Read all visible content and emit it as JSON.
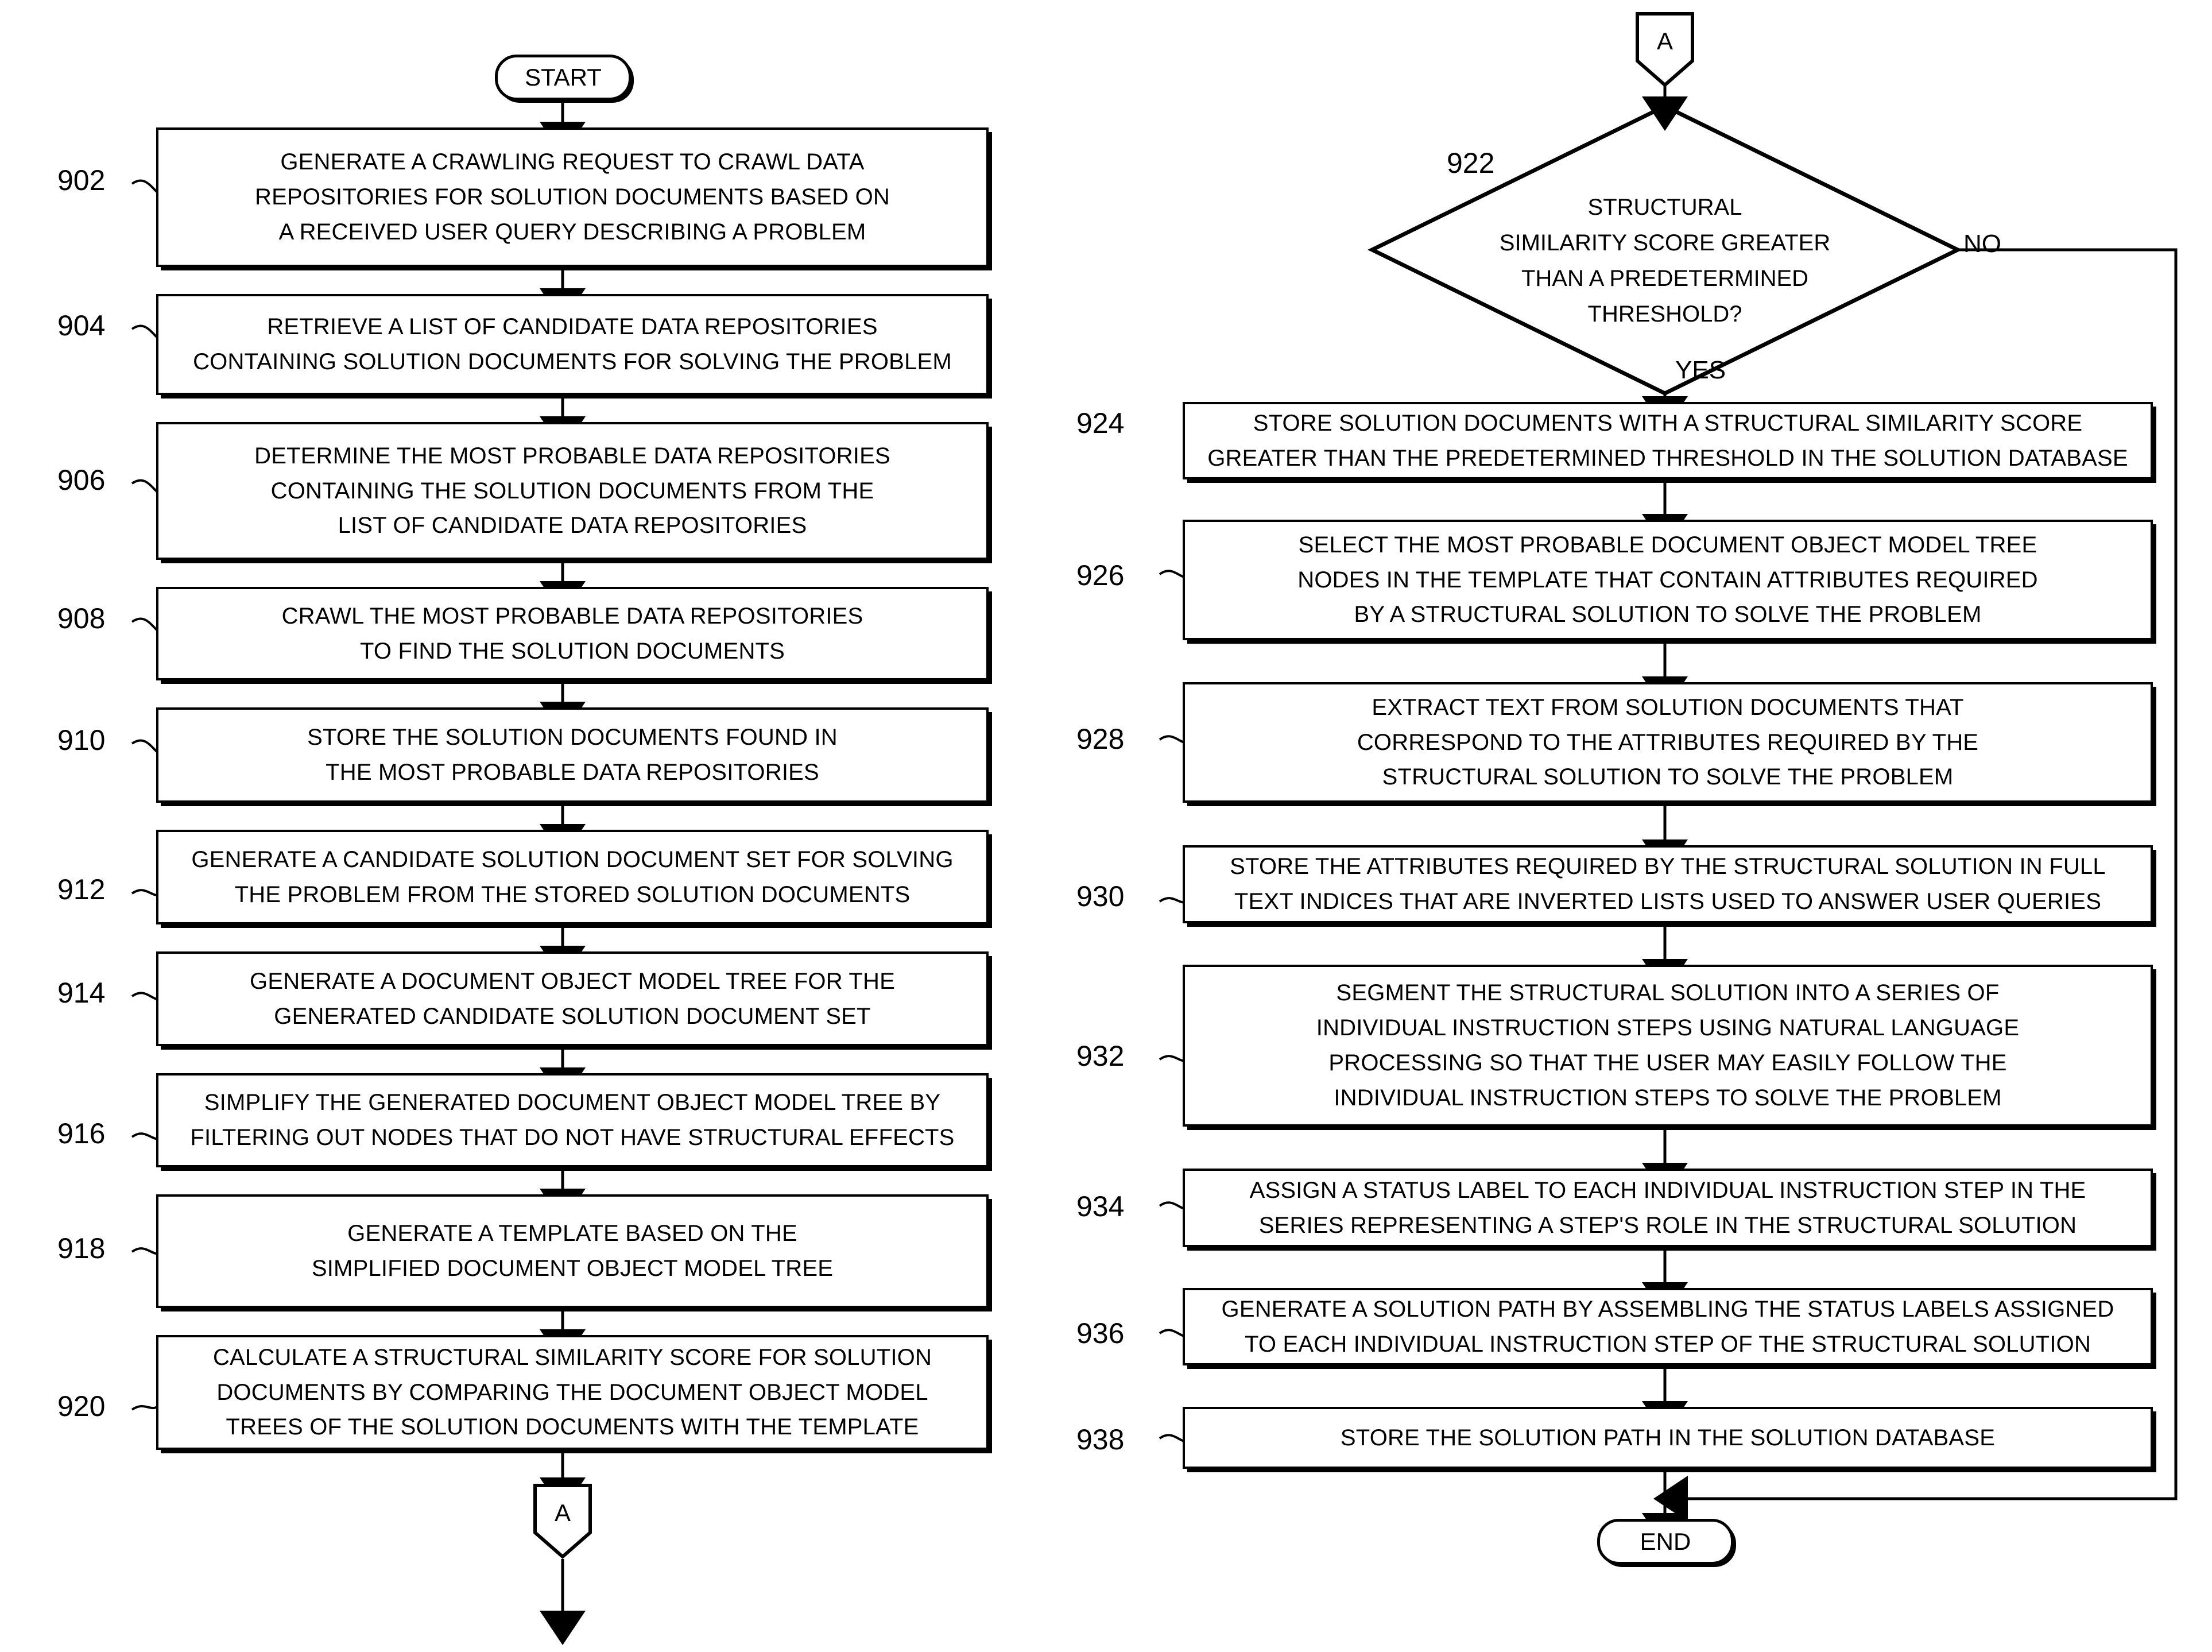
{
  "figure": {
    "start_label": "START",
    "end_label": "END",
    "connector_label": "A",
    "yes_label": "YES",
    "no_label": "NO"
  },
  "left_column": {
    "steps": [
      {
        "ref": "902",
        "lines": [
          "GENERATE A CRAWLING REQUEST TO CRAWL DATA",
          "REPOSITORIES FOR SOLUTION DOCUMENTS BASED ON",
          "A RECEIVED USER QUERY DESCRIBING A  PROBLEM"
        ]
      },
      {
        "ref": "904",
        "lines": [
          "RETRIEVE A LIST OF CANDIDATE DATA REPOSITORIES",
          "CONTAINING SOLUTION DOCUMENTS FOR SOLVING THE PROBLEM"
        ]
      },
      {
        "ref": "906",
        "lines": [
          "DETERMINE THE MOST PROBABLE DATA REPOSITORIES",
          "CONTAINING THE SOLUTION DOCUMENTS FROM THE",
          "LIST OF CANDIDATE DATA REPOSITORIES"
        ]
      },
      {
        "ref": "908",
        "lines": [
          "CRAWL THE MOST PROBABLE DATA REPOSITORIES",
          "TO FIND THE SOLUTION DOCUMENTS"
        ]
      },
      {
        "ref": "910",
        "lines": [
          "STORE THE SOLUTION DOCUMENTS FOUND IN",
          "THE MOST PROBABLE DATA REPOSITORIES"
        ]
      },
      {
        "ref": "912",
        "lines": [
          "GENERATE A CANDIDATE SOLUTION DOCUMENT SET FOR SOLVING",
          "THE PROBLEM FROM THE STORED SOLUTION DOCUMENTS"
        ]
      },
      {
        "ref": "914",
        "lines": [
          "GENERATE A DOCUMENT OBJECT MODEL TREE FOR THE",
          "GENERATED CANDIDATE SOLUTION DOCUMENT SET"
        ]
      },
      {
        "ref": "916",
        "lines": [
          "SIMPLIFY THE GENERATED DOCUMENT OBJECT MODEL TREE BY",
          "FILTERING OUT NODES THAT DO NOT HAVE STRUCTURAL EFFECTS"
        ]
      },
      {
        "ref": "918",
        "lines": [
          "GENERATE A TEMPLATE BASED ON THE",
          "SIMPLIFIED DOCUMENT OBJECT MODEL TREE"
        ]
      },
      {
        "ref": "920",
        "lines": [
          "CALCULATE A STRUCTURAL SIMILARITY SCORE FOR SOLUTION",
          "DOCUMENTS BY COMPARING THE DOCUMENT OBJECT MODEL",
          "TREES OF THE SOLUTION DOCUMENTS WITH THE TEMPLATE"
        ]
      }
    ]
  },
  "right_column": {
    "decision": {
      "ref": "922",
      "lines": [
        "STRUCTURAL",
        "SIMILARITY SCORE GREATER",
        "THAN A PREDETERMINED",
        "THRESHOLD?"
      ]
    },
    "steps": [
      {
        "ref": "924",
        "lines": [
          "STORE SOLUTION DOCUMENTS WITH A STRUCTURAL SIMILARITY SCORE",
          "GREATER THAN THE PREDETERMINED THRESHOLD IN THE SOLUTION DATABASE"
        ]
      },
      {
        "ref": "926",
        "lines": [
          "SELECT THE MOST PROBABLE DOCUMENT OBJECT MODEL TREE",
          "NODES IN THE TEMPLATE THAT CONTAIN ATTRIBUTES REQUIRED",
          "BY A STRUCTURAL SOLUTION TO SOLVE THE PROBLEM"
        ]
      },
      {
        "ref": "928",
        "lines": [
          "EXTRACT TEXT FROM SOLUTION DOCUMENTS THAT",
          "CORRESPOND TO THE ATTRIBUTES REQUIRED BY THE",
          "STRUCTURAL SOLUTION TO SOLVE THE PROBLEM"
        ]
      },
      {
        "ref": "930",
        "lines": [
          "STORE THE ATTRIBUTES REQUIRED BY THE STRUCTURAL SOLUTION IN FULL",
          "TEXT INDICES THAT ARE INVERTED LISTS USED TO ANSWER USER QUERIES"
        ]
      },
      {
        "ref": "932",
        "lines": [
          "SEGMENT THE STRUCTURAL SOLUTION INTO A SERIES OF",
          "INDIVIDUAL INSTRUCTION STEPS USING NATURAL LANGUAGE",
          "PROCESSING SO THAT THE USER MAY EASILY FOLLOW THE",
          "INDIVIDUAL INSTRUCTION STEPS TO SOLVE THE PROBLEM"
        ]
      },
      {
        "ref": "934",
        "lines": [
          "ASSIGN A STATUS LABEL TO EACH INDIVIDUAL INSTRUCTION STEP IN THE",
          "SERIES REPRESENTING A STEP'S ROLE IN THE STRUCTURAL SOLUTION"
        ]
      },
      {
        "ref": "936",
        "lines": [
          "GENERATE A SOLUTION PATH BY ASSEMBLING THE STATUS LABELS ASSIGNED",
          "TO EACH INDIVIDUAL INSTRUCTION STEP OF THE STRUCTURAL SOLUTION"
        ]
      },
      {
        "ref": "938",
        "lines": [
          "STORE THE SOLUTION PATH IN THE SOLUTION DATABASE"
        ]
      }
    ]
  },
  "colors": {
    "stroke": "#000000",
    "fill": "#ffffff"
  }
}
